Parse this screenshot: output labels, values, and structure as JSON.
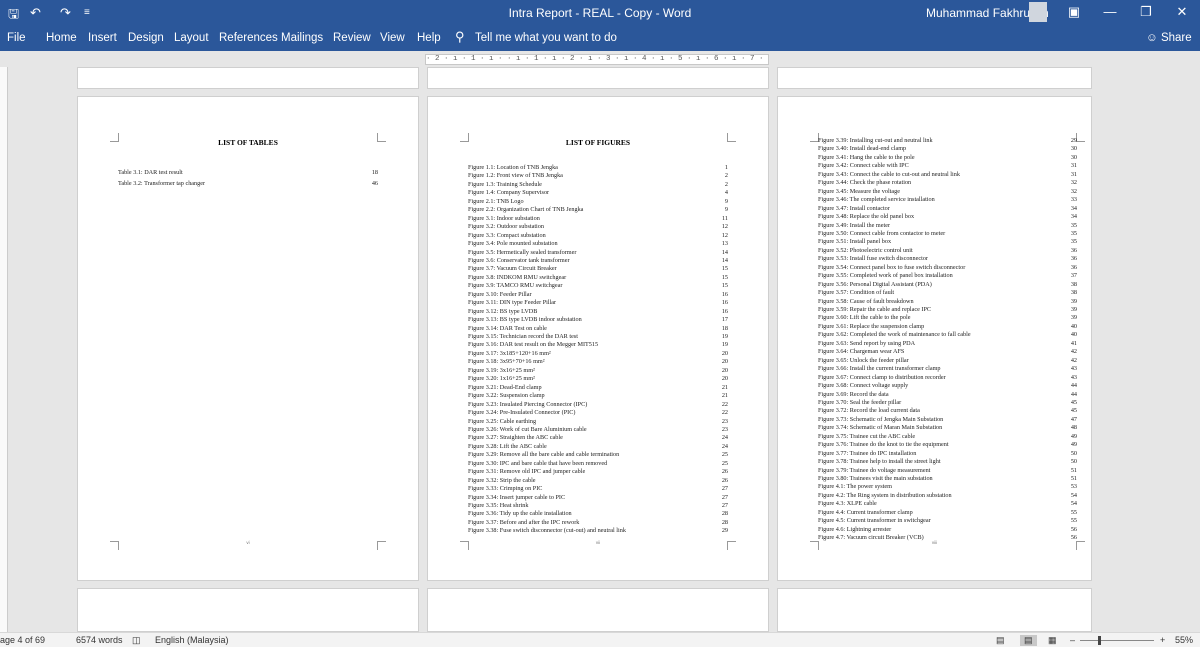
{
  "window": {
    "title": "Intra Report - REAL - Copy - Word",
    "user": "Muhammad Fakhrullah",
    "qat_icons": [
      "save-icon",
      "undo-icon",
      "redo-icon",
      "customize-qat-icon"
    ],
    "controls": [
      "ribbon-display-options-icon",
      "minimize-icon",
      "restore-icon",
      "close-icon"
    ]
  },
  "ribbon": {
    "tabs": [
      "File",
      "Home",
      "Insert",
      "Design",
      "Layout",
      "References",
      "Mailings",
      "Review",
      "View",
      "Help"
    ],
    "tell_me": "Tell me what you want to do",
    "share": "Share"
  },
  "ruler": {
    "text": "· 2 · ı · 1 · ı ·   · ı · 1 · ı · 2 · ı · 3 · ı · 4 · ı · 5 · ı · 6 · ı · 7 · ı · 8 · ı · 9 · ı · 10 · ı · 11 · ı · 12 · ı · 13 · ı · 14 · ı · 15 · ı ·    · 17 · 18"
  },
  "pages": [
    {
      "title": "LIST OF TABLES",
      "number": "vi",
      "entries": [
        {
          "label": "Table 3.1: DAR test result",
          "page": "18"
        },
        {
          "label": "Table 3.2: Transformer tap changer",
          "page": "46"
        }
      ]
    },
    {
      "title": "LIST OF FIGURES",
      "number": "vii",
      "entries": [
        {
          "label": "Figure 1.1: Location of TNB Jengka",
          "page": "1"
        },
        {
          "label": "Figure 1.2: Front view of TNB Jengka",
          "page": "2"
        },
        {
          "label": "Figure 1.3: Training Schedule",
          "page": "2"
        },
        {
          "label": "Figure 1.4: Company Supervisor",
          "page": "4"
        },
        {
          "label": "Figure 2.1: TNB Logo",
          "page": "9"
        },
        {
          "label": "Figure 2.2: Organization Chart of TNB Jengka",
          "page": "9"
        },
        {
          "label": "Figure 3.1: Indoor substation",
          "page": "11"
        },
        {
          "label": "Figure 3.2: Outdoor substation",
          "page": "12"
        },
        {
          "label": "Figure 3.3: Compact substation",
          "page": "12"
        },
        {
          "label": "Figure 3.4: Pole mounted substation",
          "page": "13"
        },
        {
          "label": "Figure 3.5: Hermetically sealed transformer",
          "page": "14"
        },
        {
          "label": "Figure 3.6: Conservator tank transformer",
          "page": "14"
        },
        {
          "label": "Figure 3.7: Vacuum Circuit Breaker",
          "page": "15"
        },
        {
          "label": "Figure 3.8: INDKOM RMU switchgear",
          "page": "15"
        },
        {
          "label": "Figure 3.9: TAMCO RMU switchgear",
          "page": "15"
        },
        {
          "label": "Figure 3.10: Feeder Pillar",
          "page": "16"
        },
        {
          "label": "Figure 3.11: DIN type Feeder Pillar",
          "page": "16"
        },
        {
          "label": "Figure 3.12: BS type LVDB",
          "page": "16"
        },
        {
          "label": "Figure 3.13: BS type LVDB indoor substation",
          "page": "17"
        },
        {
          "label": "Figure 3.14: DAR Test on cable",
          "page": "18"
        },
        {
          "label": "Figure 3.15: Technician record the DAR test",
          "page": "19"
        },
        {
          "label": "Figure 3.16: DAR test result on the Megger MIT515",
          "page": "19"
        },
        {
          "label": "Figure 3.17: 3x185+120+16 mm²",
          "page": "20"
        },
        {
          "label": "Figure 3.18: 3x95+70+16 mm²",
          "page": "20"
        },
        {
          "label": "Figure 3.19: 3x16+25 mm²",
          "page": "20"
        },
        {
          "label": "Figure 3.20: 1x16+25 mm²",
          "page": "20"
        },
        {
          "label": "Figure 3.21: Dead-End clamp",
          "page": "21"
        },
        {
          "label": "Figure 3.22: Suspension clamp",
          "page": "21"
        },
        {
          "label": "Figure 3.23: Insulated Piercing Connector (IPC)",
          "page": "22"
        },
        {
          "label": "Figure 3.24: Pre-Insulated Connector (PIC)",
          "page": "22"
        },
        {
          "label": "Figure 3.25: Cable earthing",
          "page": "23"
        },
        {
          "label": "Figure 3.26: Work of cut Bare Aluminium cable",
          "page": "23"
        },
        {
          "label": "Figure 3.27: Straighten the ABC cable",
          "page": "24"
        },
        {
          "label": "Figure 3.28: Lift the ABC cable",
          "page": "24"
        },
        {
          "label": "Figure 3.29: Remove all the bare cable and cable termination",
          "page": "25"
        },
        {
          "label": "Figure 3.30: IPC and bare cable that have been removed",
          "page": "25"
        },
        {
          "label": "Figure 3.31: Remove old IPC and jumper cable",
          "page": "26"
        },
        {
          "label": "Figure 3.32: Strip the cable",
          "page": "26"
        },
        {
          "label": "Figure 3.33: Crimping on PIC",
          "page": "27"
        },
        {
          "label": "Figure 3.34: Insert jumper cable to PIC",
          "page": "27"
        },
        {
          "label": "Figure 3.35: Heat shrink",
          "page": "27"
        },
        {
          "label": "Figure 3.36: Tidy up the cable installation",
          "page": "28"
        },
        {
          "label": "Figure 3.37: Before and after the IPC rework",
          "page": "28"
        },
        {
          "label": "Figure 3.38: Fuse switch disconnector (cut-out) and neutral link",
          "page": "29"
        }
      ]
    },
    {
      "title": "",
      "number": "viii",
      "entries": [
        {
          "label": "Figure 3.39: Installing cut-out and neutral link",
          "page": "29"
        },
        {
          "label": "Figure 3.40: Install dead-end clamp",
          "page": "30"
        },
        {
          "label": "Figure 3.41: Hang the cable to the pole",
          "page": "30"
        },
        {
          "label": "Figure 3.42: Connect cable with IPC",
          "page": "31"
        },
        {
          "label": "Figure 3.43: Connect the cable to cut-out and neutral link",
          "page": "31"
        },
        {
          "label": "Figure 3.44: Check the phase rotation",
          "page": "32"
        },
        {
          "label": "Figure 3.45: Measure the voltage",
          "page": "32"
        },
        {
          "label": "Figure 3.46: The completed service installation",
          "page": "33"
        },
        {
          "label": "Figure 3.47: Install contactor",
          "page": "34"
        },
        {
          "label": "Figure 3.48: Replace the old panel box",
          "page": "34"
        },
        {
          "label": "Figure 3.49: Install the meter",
          "page": "35"
        },
        {
          "label": "Figure 3.50: Connect cable from contactor to meter",
          "page": "35"
        },
        {
          "label": "Figure 3.51: Install panel box",
          "page": "35"
        },
        {
          "label": "Figure 3.52: Photoelectric control unit",
          "page": "36"
        },
        {
          "label": "Figure 3.53: Install fuse switch disconnector",
          "page": "36"
        },
        {
          "label": "Figure 3.54: Connect panel box to fuse switch disconnector",
          "page": "36"
        },
        {
          "label": "Figure 3.55: Completed work of panel box installation",
          "page": "37"
        },
        {
          "label": "Figure 3.56: Personal Digital Assistant (PDA)",
          "page": "38"
        },
        {
          "label": "Figure 3.57: Condition of fault",
          "page": "38"
        },
        {
          "label": "Figure 3.58: Cause of fault breakdown",
          "page": "39"
        },
        {
          "label": "Figure 3.59: Repair the cable and replace IPC",
          "page": "39"
        },
        {
          "label": "Figure 3.60: Lift the cable to the pole",
          "page": "39"
        },
        {
          "label": "Figure 3.61: Replace the suspension clamp",
          "page": "40"
        },
        {
          "label": "Figure 3.62: Completed the work of maintenance to fall cable",
          "page": "40"
        },
        {
          "label": "Figure 3.63: Send report by using PDA",
          "page": "41"
        },
        {
          "label": "Figure 3.64: Chargeman wear AFS",
          "page": "42"
        },
        {
          "label": "Figure 3.65: Unlock the feeder pillar",
          "page": "42"
        },
        {
          "label": "Figure 3.66: Install the current transformer clamp",
          "page": "43"
        },
        {
          "label": "Figure 3.67: Connect clamp to distribution recorder",
          "page": "43"
        },
        {
          "label": "Figure 3.68: Connect voltage supply",
          "page": "44"
        },
        {
          "label": "Figure 3.69: Record the data",
          "page": "44"
        },
        {
          "label": "Figure 3.70: Seal the feeder pillar",
          "page": "45"
        },
        {
          "label": "Figure 3.72: Record the load current data",
          "page": "45"
        },
        {
          "label": "Figure 3.73: Schematic of Jengka Main Substation",
          "page": "47"
        },
        {
          "label": "Figure 3.74: Schematic of Maran Main Substation",
          "page": "48"
        },
        {
          "label": "Figure 3.75: Trainee cut the ABC cable",
          "page": "49"
        },
        {
          "label": "Figure 3.76: Trainee do the knot to tie the equipment",
          "page": "49"
        },
        {
          "label": "Figure 3.77: Trainee do IPC installation",
          "page": "50"
        },
        {
          "label": "Figure 3.78: Trainee help to install the street light",
          "page": "50"
        },
        {
          "label": "Figure 3.79: Trainee do voltage measurement",
          "page": "51"
        },
        {
          "label": "Figure 3.80: Trainees visit the main substation",
          "page": "51"
        },
        {
          "label": "Figure 4.1: The power system",
          "page": "53"
        },
        {
          "label": "Figure 4.2: The Ring system in distribution substation",
          "page": "54"
        },
        {
          "label": "Figure 4.3: XLPE cable",
          "page": "54"
        },
        {
          "label": "Figure 4.4: Current transformer clamp",
          "page": "55"
        },
        {
          "label": "Figure 4.5: Current transformer in switchgear",
          "page": "55"
        },
        {
          "label": "Figure 4.6: Lightning arrester",
          "page": "56"
        },
        {
          "label": "Figure 4.7: Vacuum circuit Breaker (VCB)",
          "page": "56"
        }
      ]
    }
  ],
  "status": {
    "page": "age 4 of 69",
    "words": "6574 words",
    "language": "English (Malaysia)",
    "zoom": "55%",
    "views": [
      "read-mode-icon",
      "print-layout-icon",
      "web-layout-icon"
    ],
    "zoom_level": 0.55
  }
}
